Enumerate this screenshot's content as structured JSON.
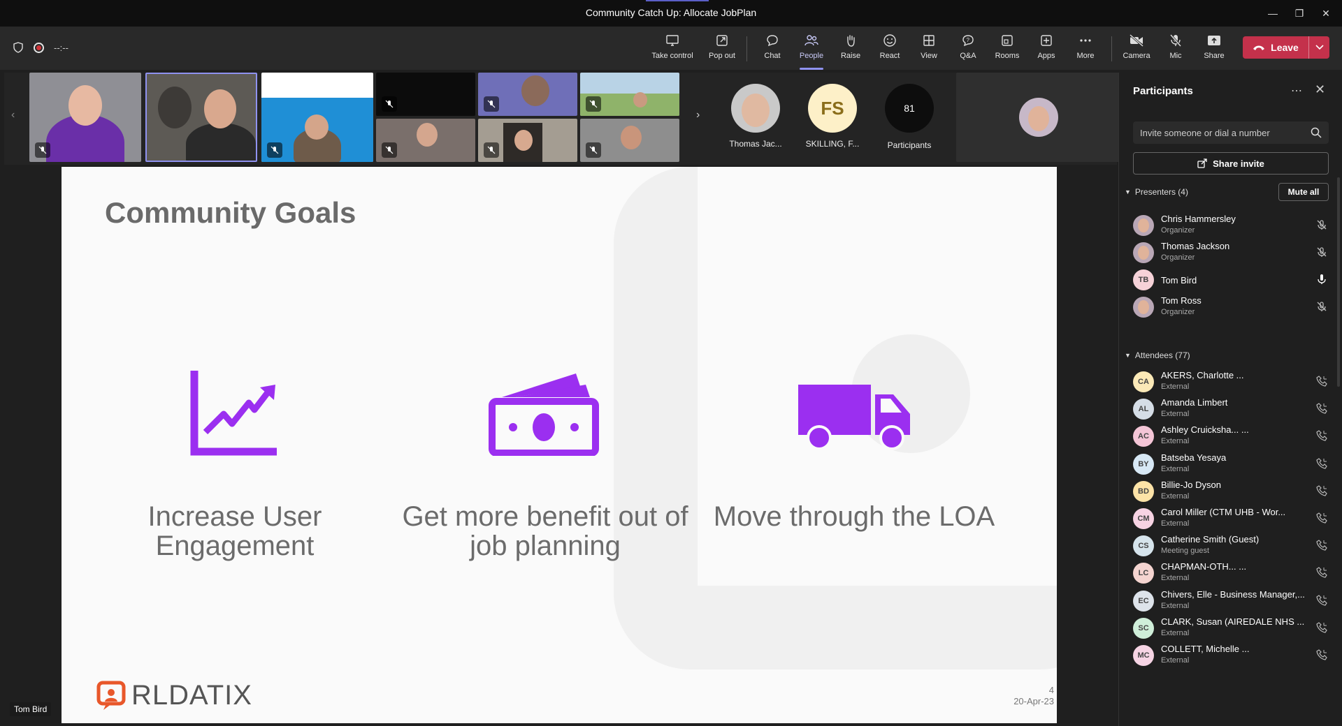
{
  "window": {
    "title": "Community Catch Up: Allocate JobPlan"
  },
  "meeting": {
    "timer": "--:--"
  },
  "toolbar": {
    "buttons": [
      {
        "label": "Take control",
        "icon": "take-control-icon"
      },
      {
        "label": "Pop out",
        "icon": "pop-out-icon"
      },
      {
        "label": "Chat",
        "icon": "chat-icon"
      },
      {
        "label": "People",
        "icon": "people-icon"
      },
      {
        "label": "Raise",
        "icon": "raise-hand-icon"
      },
      {
        "label": "React",
        "icon": "react-icon"
      },
      {
        "label": "View",
        "icon": "view-icon"
      },
      {
        "label": "Q&A",
        "icon": "qa-icon"
      },
      {
        "label": "Rooms",
        "icon": "rooms-icon"
      },
      {
        "label": "Apps",
        "icon": "apps-icon"
      },
      {
        "label": "More",
        "icon": "more-icon"
      },
      {
        "label": "Camera",
        "icon": "camera-off-icon"
      },
      {
        "label": "Mic",
        "icon": "mic-off-icon"
      },
      {
        "label": "Share",
        "icon": "share-icon"
      }
    ],
    "leave_label": "Leave",
    "leave_color": "#c4314b"
  },
  "gallery": {
    "featured": [
      {
        "name": "Thomas Jac...",
        "type": "photo"
      },
      {
        "name": "SKILLING, F...",
        "initials": "FS",
        "color": "#fdf0c8"
      },
      {
        "name": "Participants",
        "count": "81"
      }
    ]
  },
  "slide": {
    "title": "Community Goals",
    "goals": [
      {
        "text": "Increase User Engagement",
        "icon": "growth-chart-icon"
      },
      {
        "text": "Get more benefit out of job planning",
        "icon": "money-icon"
      },
      {
        "text": "Move through the LOA",
        "icon": "truck-icon"
      }
    ],
    "accent_color": "#9b2ff0",
    "logo_text": "RLDATIX",
    "page_number": "4",
    "date": "20-Apr-23"
  },
  "speaker": {
    "name": "Tom Bird"
  },
  "panel": {
    "title": "Participants",
    "invite_placeholder": "Invite someone or dial a number",
    "share_invite": "Share invite",
    "mute_all": "Mute all",
    "presenters_header": "Presenters (4)",
    "attendees_header": "Attendees (77)",
    "presenters": [
      {
        "name": "Chris Hammersley",
        "role": "Organizer",
        "initials": "",
        "mic": "off"
      },
      {
        "name": "Thomas Jackson",
        "role": "Organizer",
        "initials": "",
        "mic": "off"
      },
      {
        "name": "Tom Bird",
        "role": "",
        "initials": "TB",
        "mic": "on",
        "color": "#f6d2d8"
      },
      {
        "name": "Tom Ross",
        "role": "Organizer",
        "initials": "",
        "mic": "off"
      }
    ],
    "attendees": [
      {
        "name": "AKERS, Charlotte ...",
        "role": "External",
        "initials": "CA",
        "color": "#fbe9b7"
      },
      {
        "name": "Amanda Limbert",
        "role": "External",
        "initials": "AL",
        "color": "#d5dde6"
      },
      {
        "name": "Ashley Cruicksha... ...",
        "role": "External",
        "initials": "AC",
        "color": "#f4c5d6"
      },
      {
        "name": "Batseba Yesaya",
        "role": "External",
        "initials": "BY",
        "color": "#d7e8f5"
      },
      {
        "name": "Billie-Jo Dyson",
        "role": "External",
        "initials": "BD",
        "color": "#fde3a7"
      },
      {
        "name": "Carol Miller (CTM UHB - Wor...",
        "role": "External",
        "initials": "CM",
        "color": "#f7d3e3"
      },
      {
        "name": "Catherine Smith (Guest)",
        "role": "Meeting guest",
        "initials": "CS",
        "color": "#d6e4ec"
      },
      {
        "name": "CHAPMAN-OTH... ...",
        "role": "External",
        "initials": "LC",
        "color": "#f4d4d0"
      },
      {
        "name": "Chivers, Elle - Business Manager,...",
        "role": "External",
        "initials": "EC",
        "color": "#dde3ea"
      },
      {
        "name": "CLARK, Susan (AIREDALE NHS ...",
        "role": "External",
        "initials": "SC",
        "color": "#cfeed9"
      },
      {
        "name": "COLLETT, Michelle ...",
        "role": "External",
        "initials": "MC",
        "color": "#f6d4e4"
      }
    ]
  }
}
